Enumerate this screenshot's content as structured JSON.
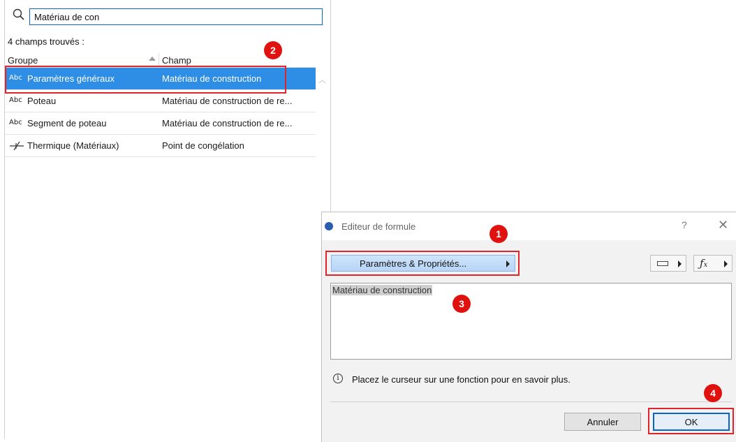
{
  "search_panel": {
    "search_value": "Matériau de con",
    "found_label": "4 champs trouvés :",
    "columns": {
      "group": "Groupe",
      "field": "Champ"
    },
    "rows": [
      {
        "icon": "Abc",
        "group": "Paramètres généraux",
        "field": "Matériau de construction"
      },
      {
        "icon": "Abc",
        "group": "Poteau",
        "field": "Matériau de construction de re..."
      },
      {
        "icon": "Abc",
        "group": "Segment de poteau",
        "field": "Matériau de construction de re..."
      },
      {
        "icon": "thermal-icon",
        "group": "Thermique (Matériaux)",
        "field": "Point de congélation"
      }
    ]
  },
  "dialog": {
    "title": "Editeur de formule",
    "help": "?",
    "close": "✕",
    "param_button": "Paramètres & Propriétés...",
    "formula": "Matériau de construction",
    "info": "Placez le curseur sur une fonction pour en savoir plus.",
    "cancel": "Annuler",
    "ok": "OK"
  },
  "annotations": {
    "badge1": "1",
    "badge2": "2",
    "badge3": "3",
    "badge4": "4"
  },
  "colors": {
    "accent_red": "#e0242b",
    "selection_blue": "#2e8ee5",
    "focus_blue": "#0a64c8"
  }
}
